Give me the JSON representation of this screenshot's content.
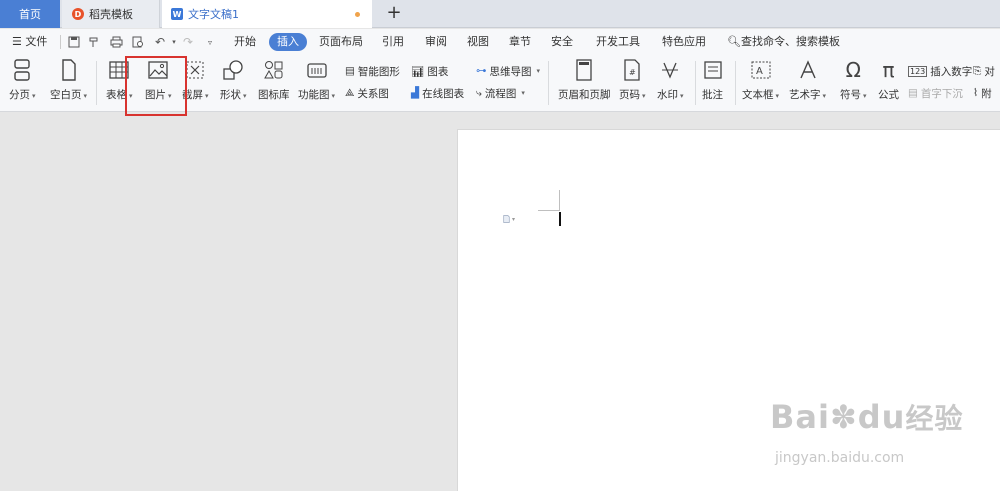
{
  "tabs": {
    "home": "首页",
    "template": "稻壳模板",
    "document": "文字文稿1",
    "add": "+"
  },
  "menubar": {
    "file": "文件",
    "items": [
      "开始",
      "插入",
      "页面布局",
      "引用",
      "审阅",
      "视图",
      "章节",
      "安全",
      "开发工具",
      "特色应用"
    ],
    "active_index": 1,
    "search": "查找命令、搜索模板"
  },
  "ribbon": {
    "page_break": "分页",
    "blank_page": "空白页",
    "table": "表格",
    "picture": "图片",
    "screenshot": "截屏",
    "shape": "形状",
    "icon_lib": "图标库",
    "function_chart": "功能图",
    "smart_art": "智能图形",
    "chart": "图表",
    "mind_map": "思维导图",
    "relation": "关系图",
    "online_chart": "在线图表",
    "flow_chart": "流程图",
    "header_footer": "页眉和页脚",
    "page_number": "页码",
    "watermark": "水印",
    "comment": "批注",
    "text_box": "文本框",
    "word_art": "艺术字",
    "symbol": "符号",
    "formula": "公式",
    "insert_number": "插入数字",
    "object": "对",
    "drop_cap": "首字下沉",
    "attachment": "附"
  },
  "watermark": {
    "brand": "Bai",
    "brand_cn": "经验",
    "du": "du",
    "url": "jingyan.baidu.com"
  },
  "colors": {
    "accent": "#4a7fd4",
    "highlight_box": "#d8332f"
  }
}
